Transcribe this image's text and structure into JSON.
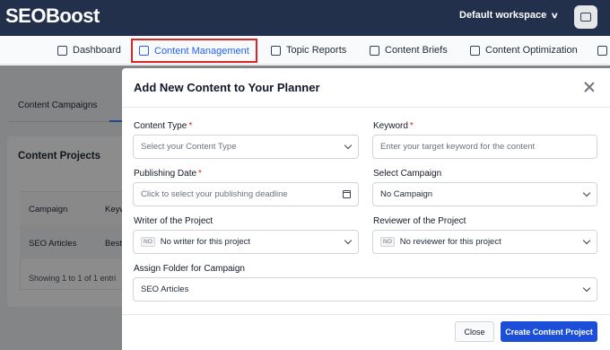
{
  "header": {
    "logo": "SEOBoost",
    "workspace": "Default workspace"
  },
  "nav": {
    "items": [
      {
        "label": "Dashboard",
        "icon": "dashboard-icon"
      },
      {
        "label": "Content Management",
        "icon": "content-management-icon",
        "active": true
      },
      {
        "label": "Topic Reports",
        "icon": "folder-icon"
      },
      {
        "label": "Content Briefs",
        "icon": "brief-icon"
      },
      {
        "label": "Content Optimization",
        "icon": "optimization-icon"
      }
    ]
  },
  "background": {
    "tab_label": "Content Campaigns",
    "card_title": "Content Projects",
    "table": {
      "headers": [
        "Campaign",
        "Keyw"
      ],
      "rows": [
        [
          "SEO Articles",
          "Best"
        ]
      ]
    },
    "footer": "Showing 1 to 1 of 1 entri"
  },
  "modal": {
    "title": "Add New Content to Your Planner",
    "fields": {
      "content_type": {
        "label": "Content Type",
        "required": "*",
        "placeholder": "Select your Content Type"
      },
      "keyword": {
        "label": "Keyword",
        "required": "*",
        "placeholder": "Enter your target keyword for the content"
      },
      "publishing_date": {
        "label": "Publishing Date",
        "required": "*",
        "placeholder": "Click to select your publishing deadline"
      },
      "campaign": {
        "label": "Select Campaign",
        "value": "No Campaign"
      },
      "writer": {
        "label": "Writer of the Project",
        "badge": "NO",
        "value": "No writer for this project"
      },
      "reviewer": {
        "label": "Reviewer of the Project",
        "badge": "NO",
        "value": "No reviewer for this project"
      },
      "folder": {
        "label": "Assign Folder for Campaign",
        "value": "SEO Articles"
      }
    },
    "buttons": {
      "close": "Close",
      "create": "Create Content Project"
    }
  },
  "colors": {
    "topbar": "#22304b",
    "accent": "#2563eb",
    "primary_button": "#1d4ed8",
    "active_outline": "#dc2626"
  }
}
